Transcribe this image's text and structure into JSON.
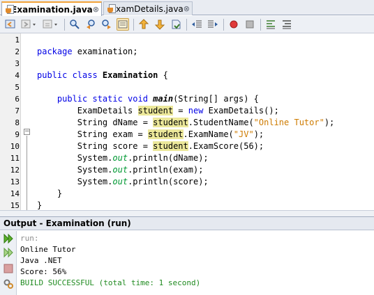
{
  "tabs": [
    {
      "label": "Examination.java",
      "close": "⊗",
      "active": true
    },
    {
      "label": "ExamDetails.java",
      "close": "⊗",
      "active": false
    }
  ],
  "toolbar": {
    "buttons": [
      "back-icon",
      "forward-icon",
      "history-icon",
      "find-selection-icon",
      "find-previous-icon",
      "find-next-icon",
      "toggle-highlight-icon",
      "previous-bookmark-icon",
      "next-bookmark-icon",
      "toggle-bookmark-icon",
      "shift-left-icon",
      "shift-right-icon",
      "start-macro-icon",
      "stop-macro-icon",
      "comment-icon",
      "uncomment-icon"
    ]
  },
  "editor": {
    "line_numbers": [
      "1",
      "2",
      "3",
      "4",
      "5",
      "6",
      "7",
      "8",
      "9",
      "10",
      "11",
      "12",
      "13",
      "14",
      "15"
    ],
    "fold_marker": "−",
    "lines": [
      {
        "segments": []
      },
      {
        "segments": [
          {
            "t": "package ",
            "c": "kw"
          },
          {
            "t": "examination;",
            "c": ""
          }
        ]
      },
      {
        "segments": []
      },
      {
        "segments": [
          {
            "t": "public class ",
            "c": "kw"
          },
          {
            "t": "Examination",
            "c": "bold"
          },
          {
            "t": " {",
            "c": ""
          }
        ]
      },
      {
        "segments": []
      },
      {
        "segments": [
          {
            "t": "    public static void ",
            "c": "kw"
          },
          {
            "t": "main",
            "c": "bolditalic"
          },
          {
            "t": "(String[] args) {",
            "c": ""
          }
        ]
      },
      {
        "segments": [
          {
            "t": "        ExamDetails ",
            "c": ""
          },
          {
            "t": "student",
            "c": "hl"
          },
          {
            "t": " = ",
            "c": ""
          },
          {
            "t": "new",
            "c": "kw"
          },
          {
            "t": " ExamDetails();",
            "c": ""
          }
        ]
      },
      {
        "segments": [
          {
            "t": "        String dName = ",
            "c": ""
          },
          {
            "t": "student",
            "c": "hl"
          },
          {
            "t": ".StudentName(",
            "c": ""
          },
          {
            "t": "\"Online Tutor\"",
            "c": "str"
          },
          {
            "t": ");",
            "c": ""
          }
        ]
      },
      {
        "segments": [
          {
            "t": "        String exam = ",
            "c": ""
          },
          {
            "t": "student",
            "c": "hl"
          },
          {
            "t": ".ExamName(",
            "c": ""
          },
          {
            "t": "\"JV\"",
            "c": "str"
          },
          {
            "t": ");",
            "c": ""
          }
        ]
      },
      {
        "segments": [
          {
            "t": "        String score = ",
            "c": ""
          },
          {
            "t": "student",
            "c": "hl"
          },
          {
            "t": ".ExamScore(56);",
            "c": ""
          }
        ]
      },
      {
        "segments": [
          {
            "t": "        System.",
            "c": ""
          },
          {
            "t": "out",
            "c": "ital"
          },
          {
            "t": ".println(dName);",
            "c": ""
          }
        ]
      },
      {
        "segments": [
          {
            "t": "        System.",
            "c": ""
          },
          {
            "t": "out",
            "c": "ital"
          },
          {
            "t": ".println(exam);",
            "c": ""
          }
        ]
      },
      {
        "segments": [
          {
            "t": "        System.",
            "c": ""
          },
          {
            "t": "out",
            "c": "ital"
          },
          {
            "t": ".println(score);",
            "c": ""
          }
        ]
      },
      {
        "segments": [
          {
            "t": "    }",
            "c": ""
          }
        ]
      },
      {
        "segments": [
          {
            "t": "}",
            "c": ""
          }
        ]
      }
    ]
  },
  "output": {
    "title": "Output - Examination (run)",
    "lines": [
      {
        "text": "run:",
        "c": "gray"
      },
      {
        "text": "Online Tutor",
        "c": ""
      },
      {
        "text": "Java .NET",
        "c": ""
      },
      {
        "text": "Score: 56%",
        "c": ""
      },
      {
        "text": "BUILD SUCCESSFUL (total time: 1 second)",
        "c": "green"
      }
    ],
    "side_icons": [
      "rerun-icon",
      "rerun-with-options-icon",
      "stop-icon",
      "settings-icon"
    ]
  },
  "colors": {
    "keyword": "#0000e6",
    "string": "#ce7b00",
    "highlight": "#ece89a",
    "static_field": "#009933",
    "build_success": "#1f8a1f",
    "active_tab_accent": "#f2a33a"
  }
}
